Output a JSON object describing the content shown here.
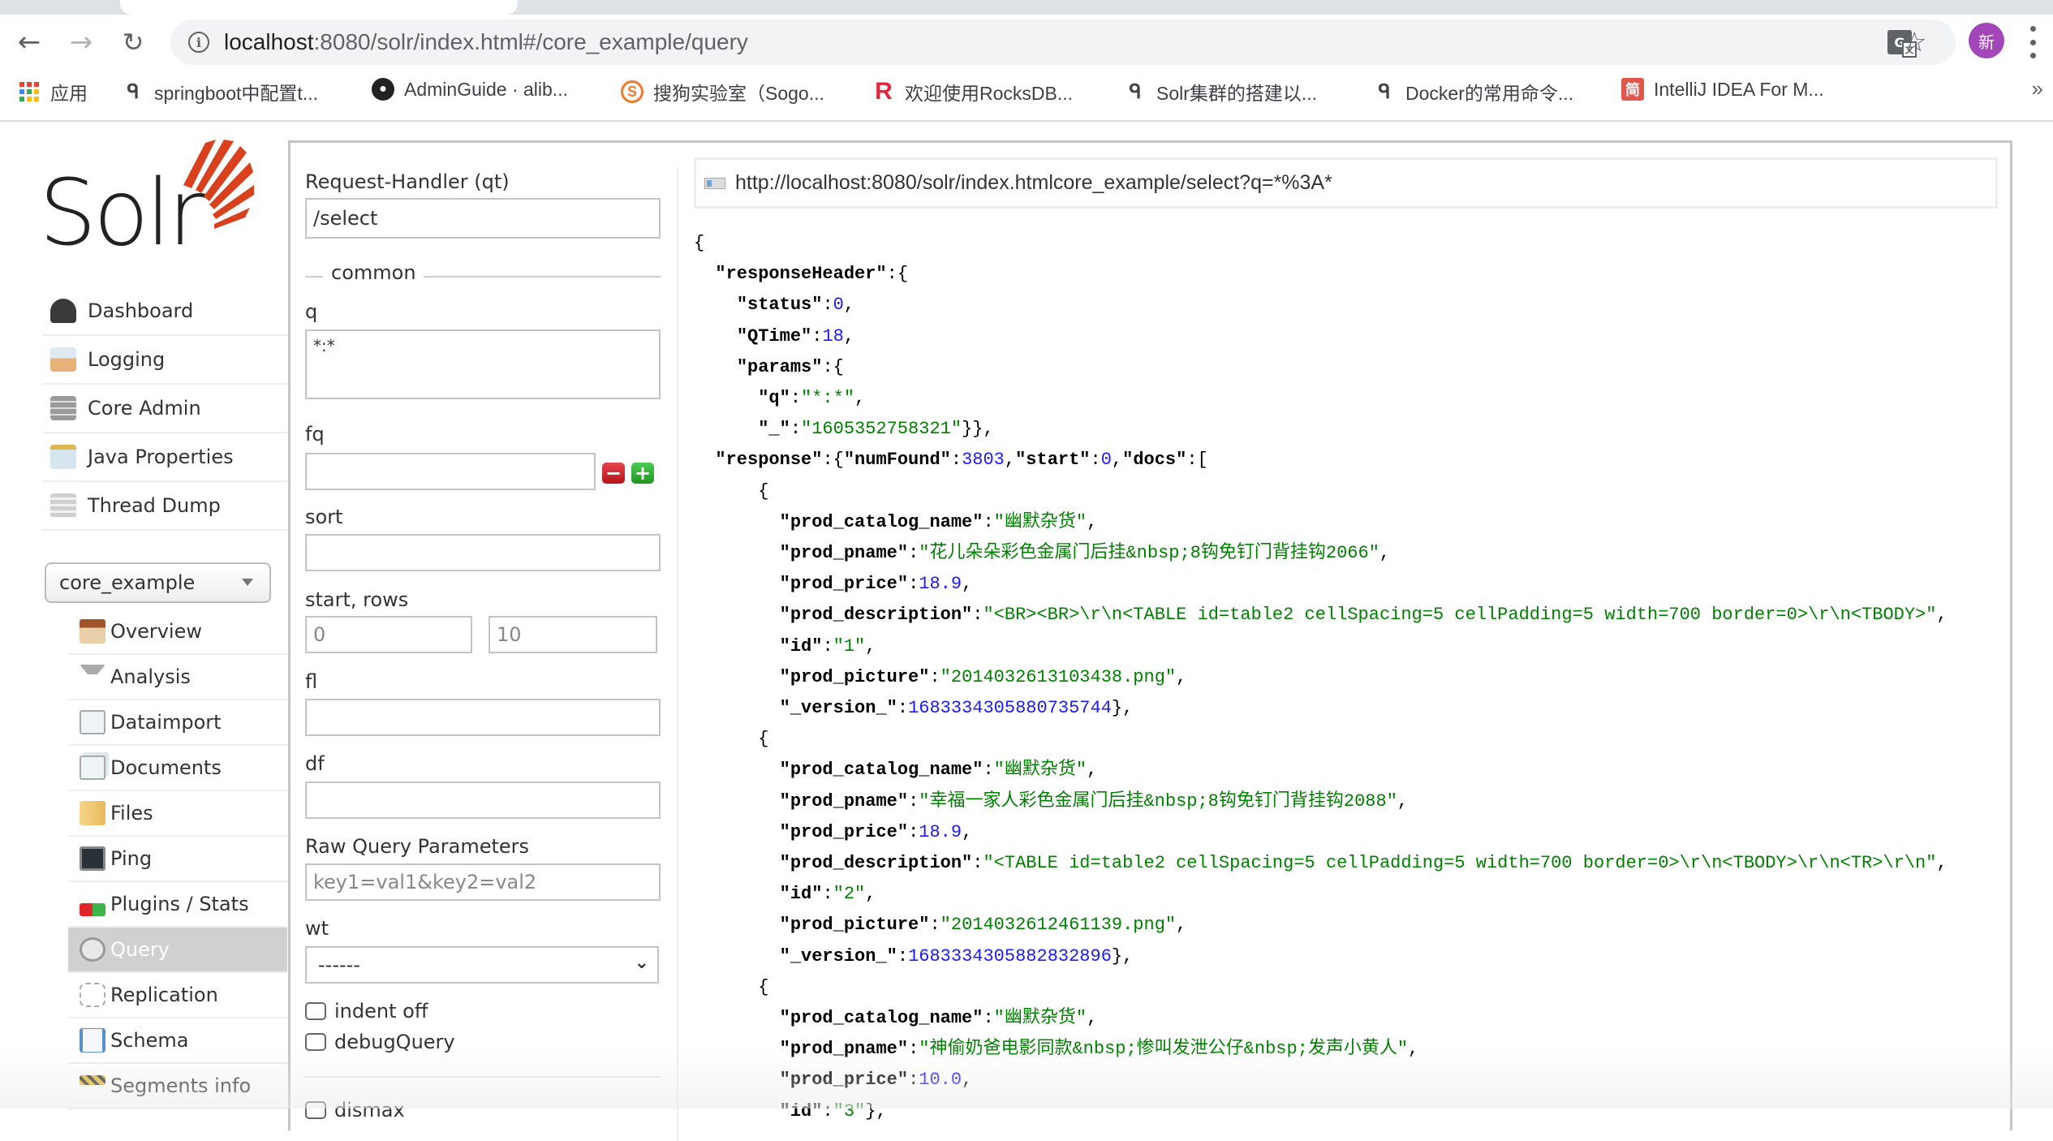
{
  "browser": {
    "nav": {
      "back": "←",
      "forward": "→",
      "reload": "↻"
    },
    "address": {
      "host": "localhost",
      "rest": ":8080/solr/index.html#/core_example/query"
    },
    "translate_glyph": "G",
    "translate_sub": "文",
    "star": "☆",
    "profile_initial": "新",
    "more_bookmarks": "»",
    "bookmarks": [
      {
        "label": "应用",
        "icon": "apps-grid-icon"
      },
      {
        "label": "springboot中配置t...",
        "icon": "bookmark-sparrow-icon"
      },
      {
        "label": "AdminGuide · alib...",
        "icon": "github-icon"
      },
      {
        "label": "搜狗实验室（Sogo...",
        "icon": "sogou-icon"
      },
      {
        "label": "欢迎使用RocksDB...",
        "icon": "rocksdb-icon"
      },
      {
        "label": "Solr集群的搭建以...",
        "icon": "bookmark-sparrow-icon"
      },
      {
        "label": "Docker的常用命令...",
        "icon": "bookmark-sparrow-icon"
      },
      {
        "label": "IntelliJ IDEA For M...",
        "icon": "jian-icon"
      }
    ]
  },
  "sidebar": {
    "logo_text": "Solr",
    "items": [
      {
        "label": "Dashboard",
        "icon": "dashboard-gauge-icon",
        "color": "#3a3a3a"
      },
      {
        "label": "Logging",
        "icon": "logging-inbox-icon",
        "color": "#e6b27a"
      },
      {
        "label": "Core Admin",
        "icon": "core-admin-servers-icon",
        "color": "#9a9a9a"
      },
      {
        "label": "Java Properties",
        "icon": "java-properties-jar-icon",
        "color": "#c9dde8"
      },
      {
        "label": "Thread Dump",
        "icon": "thread-dump-stack-icon",
        "color": "#cfcfcf"
      }
    ],
    "core_selector": {
      "value": "core_example"
    },
    "core_items": [
      {
        "label": "Overview",
        "icon": "home-icon",
        "color": "#d8a874",
        "active": false
      },
      {
        "label": "Analysis",
        "icon": "funnel-icon",
        "color": "#9c9c9c",
        "active": false
      },
      {
        "label": "Dataimport",
        "icon": "dataimport-icon",
        "color": "#e3eef2",
        "active": false
      },
      {
        "label": "Documents",
        "icon": "documents-icon",
        "color": "#e3eef2",
        "active": false
      },
      {
        "label": "Files",
        "icon": "folder-icon",
        "color": "#f0c766",
        "active": false
      },
      {
        "label": "Ping",
        "icon": "ping-monitor-icon",
        "color": "#555",
        "active": false
      },
      {
        "label": "Plugins / Stats",
        "icon": "plugins-blocks-icon",
        "color": "#2e7bd6",
        "active": false
      },
      {
        "label": "Query",
        "icon": "magnifier-icon",
        "color": "#b9b9b9",
        "active": true
      },
      {
        "label": "Replication",
        "icon": "replication-icon",
        "color": "#d8d8d8",
        "active": false
      },
      {
        "label": "Schema",
        "icon": "schema-book-icon",
        "color": "#8fb8e0",
        "active": false
      },
      {
        "label": "Segments info",
        "icon": "segments-barrier-icon",
        "color": "#e0b530",
        "active": false
      }
    ]
  },
  "form": {
    "request_handler": {
      "label": "Request-Handler (qt)",
      "value": "/select"
    },
    "common_legend": "common",
    "q": {
      "label": "q",
      "value": "*:*"
    },
    "fq": {
      "label": "fq",
      "value": "",
      "remove": "−",
      "add": "+"
    },
    "sort": {
      "label": "sort",
      "value": ""
    },
    "start_rows": {
      "label": "start, rows",
      "start_placeholder": "0",
      "rows_placeholder": "10"
    },
    "fl": {
      "label": "fl",
      "value": ""
    },
    "df": {
      "label": "df",
      "value": ""
    },
    "raw": {
      "label": "Raw Query Parameters",
      "placeholder": "key1=val1&key2=val2"
    },
    "wt": {
      "label": "wt",
      "selected": "------"
    },
    "checkboxes": [
      {
        "label": "indent off",
        "checked": false
      },
      {
        "label": "debugQuery",
        "checked": false
      },
      {
        "label": "dismax",
        "checked": false
      }
    ]
  },
  "result": {
    "request_url": "http://localhost:8080/solr/index.htmlcore_example/select?q=*%3A*",
    "responseHeader": {
      "status": 0,
      "QTime": 18,
      "params": {
        "q": "*:*",
        "_": "1605352758321"
      }
    },
    "response": {
      "numFound": 3803,
      "start": 0
    },
    "docs": [
      {
        "prod_catalog_name": "幽默杂货",
        "prod_pname": "花儿朵朵彩色金属门后挂&nbsp;8钩免钉门背挂钩2066",
        "prod_price": "18.9",
        "prod_description": "<BR><BR>\\r\\n<TABLE id=table2 cellSpacing=5 cellPadding=5 width=700 border=0>\\r\\n<TBODY>",
        "id": "1",
        "prod_picture": "2014032613103438.png",
        "_version_": "1683334305880735744"
      },
      {
        "prod_catalog_name": "幽默杂货",
        "prod_pname": "幸福一家人彩色金属门后挂&nbsp;8钩免钉门背挂钩2088",
        "prod_price": "18.9",
        "prod_description": "<TABLE id=table2 cellSpacing=5 cellPadding=5 width=700 border=0>\\r\\n<TBODY>\\r\\n<TR>\\r\\n",
        "id": "2",
        "prod_picture": "2014032612461139.png",
        "_version_": "1683334305882832896"
      },
      {
        "prod_catalog_name": "幽默杂货",
        "prod_pname": "神偷奶爸电影同款&nbsp;惨叫发泄公仔&nbsp;发声小黄人",
        "prod_price": "10.0",
        "id": "3"
      }
    ]
  },
  "colors": {
    "solr_red": "#d9411e",
    "json_string": "#008000",
    "json_number": "#1a1aff",
    "active_nav_bg": "#d0d0d0",
    "profile_bg": "#a346b8"
  }
}
